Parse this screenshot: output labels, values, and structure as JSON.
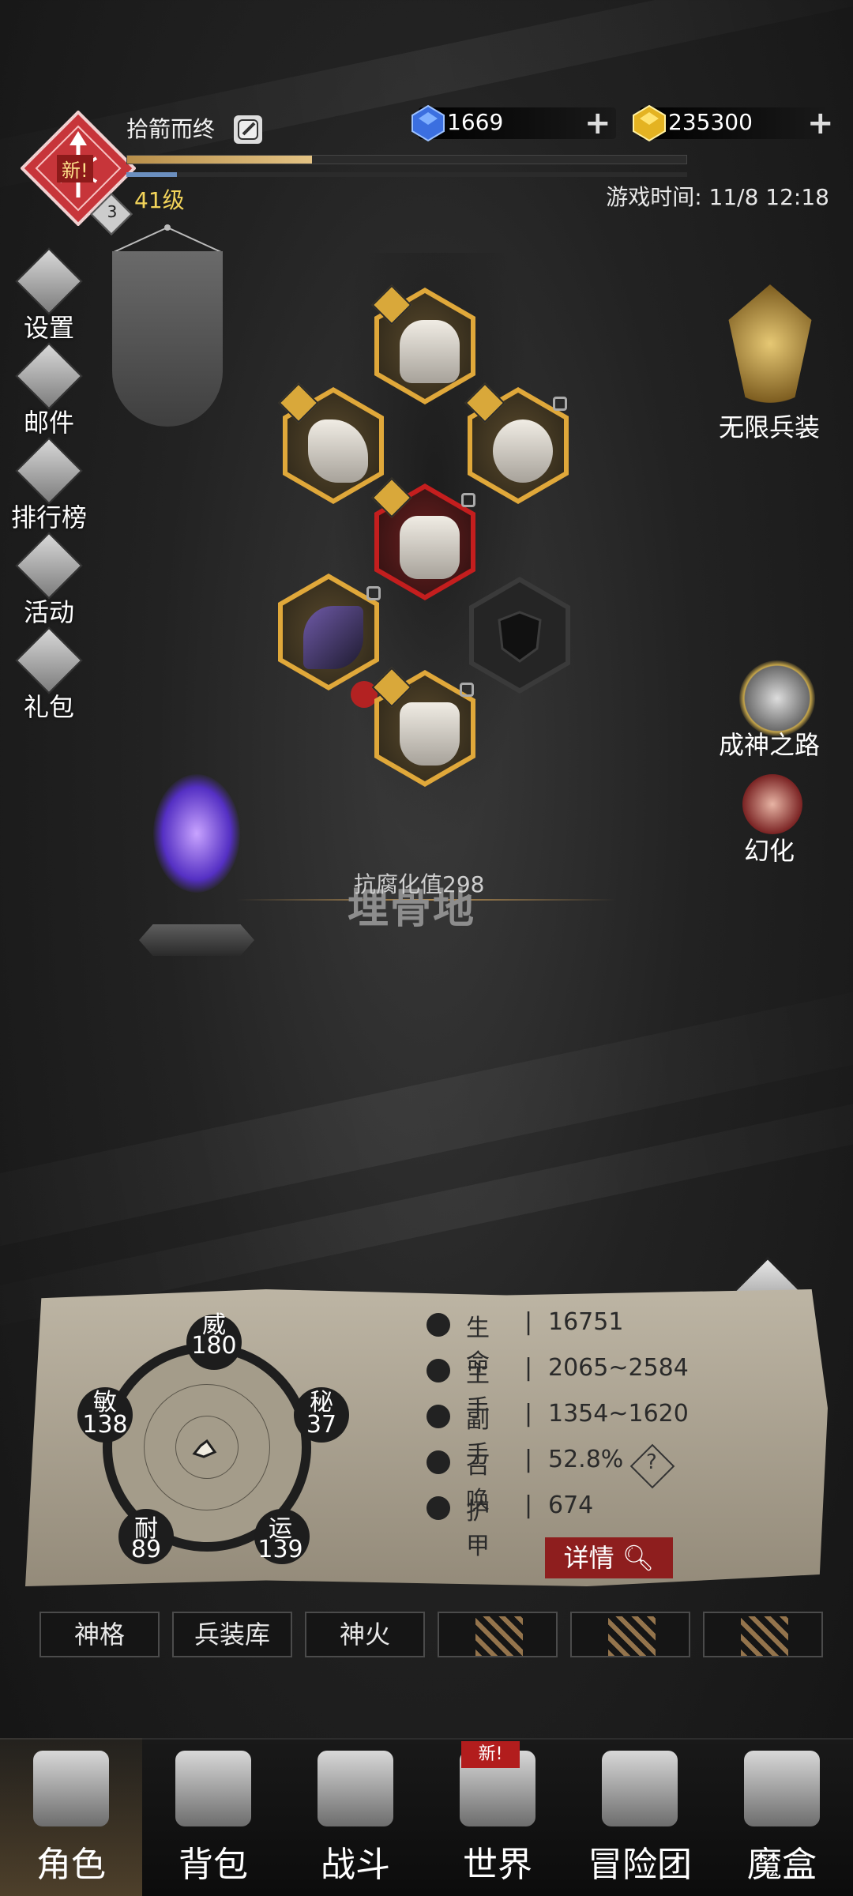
{
  "player": {
    "name": "拾箭而终",
    "level_text": "41级",
    "badge_level": "3",
    "new_tag": "新!",
    "exp_fraction": 0.33
  },
  "currency": {
    "gems": "1669",
    "gold": "235300"
  },
  "game_time": "游戏时间: 11/8 12:18",
  "left_menu": [
    {
      "label": "设置",
      "icon": "gear-icon"
    },
    {
      "label": "邮件",
      "icon": "mail-icon"
    },
    {
      "label": "排行榜",
      "icon": "ranking-icon"
    },
    {
      "label": "活动",
      "icon": "activity-icon"
    },
    {
      "label": "礼包",
      "icon": "gift-icon"
    }
  ],
  "right_menu": {
    "infinite": "无限兵装",
    "godpath": "成神之路",
    "illusion": "幻化"
  },
  "location": {
    "title": "埋骨地",
    "resist": "抗腐化值298"
  },
  "attributes": {
    "wei": {
      "name": "威",
      "value": "180"
    },
    "mi": {
      "name": "秘",
      "value": "37"
    },
    "yun": {
      "name": "运",
      "value": "139"
    },
    "nai": {
      "name": "耐",
      "value": "89"
    },
    "min": {
      "name": "敏",
      "value": "138"
    }
  },
  "stats": [
    {
      "label": "生命",
      "value": "16751",
      "icon": "heart-icon"
    },
    {
      "label": "主手",
      "value": "2065~2584",
      "icon": "sword-icon"
    },
    {
      "label": "副手",
      "value": "1354~1620",
      "icon": "offhand-icon"
    },
    {
      "label": "召唤",
      "value": "52.8%",
      "icon": "summon-icon"
    },
    {
      "label": "护甲",
      "value": "674",
      "icon": "armor-icon"
    }
  ],
  "summon_help": "?",
  "detail_button": "详情",
  "tabs": [
    "神格",
    "兵装库",
    "神火",
    "",
    "",
    ""
  ],
  "bottom_nav": [
    "角色",
    "背包",
    "战斗",
    "世界",
    "冒险团",
    "魔盒"
  ],
  "world_new": "新!",
  "colors": {
    "accent_gold": "#e0a83a",
    "danger_red": "#c41e1e",
    "level_yellow": "#f3d45a"
  }
}
